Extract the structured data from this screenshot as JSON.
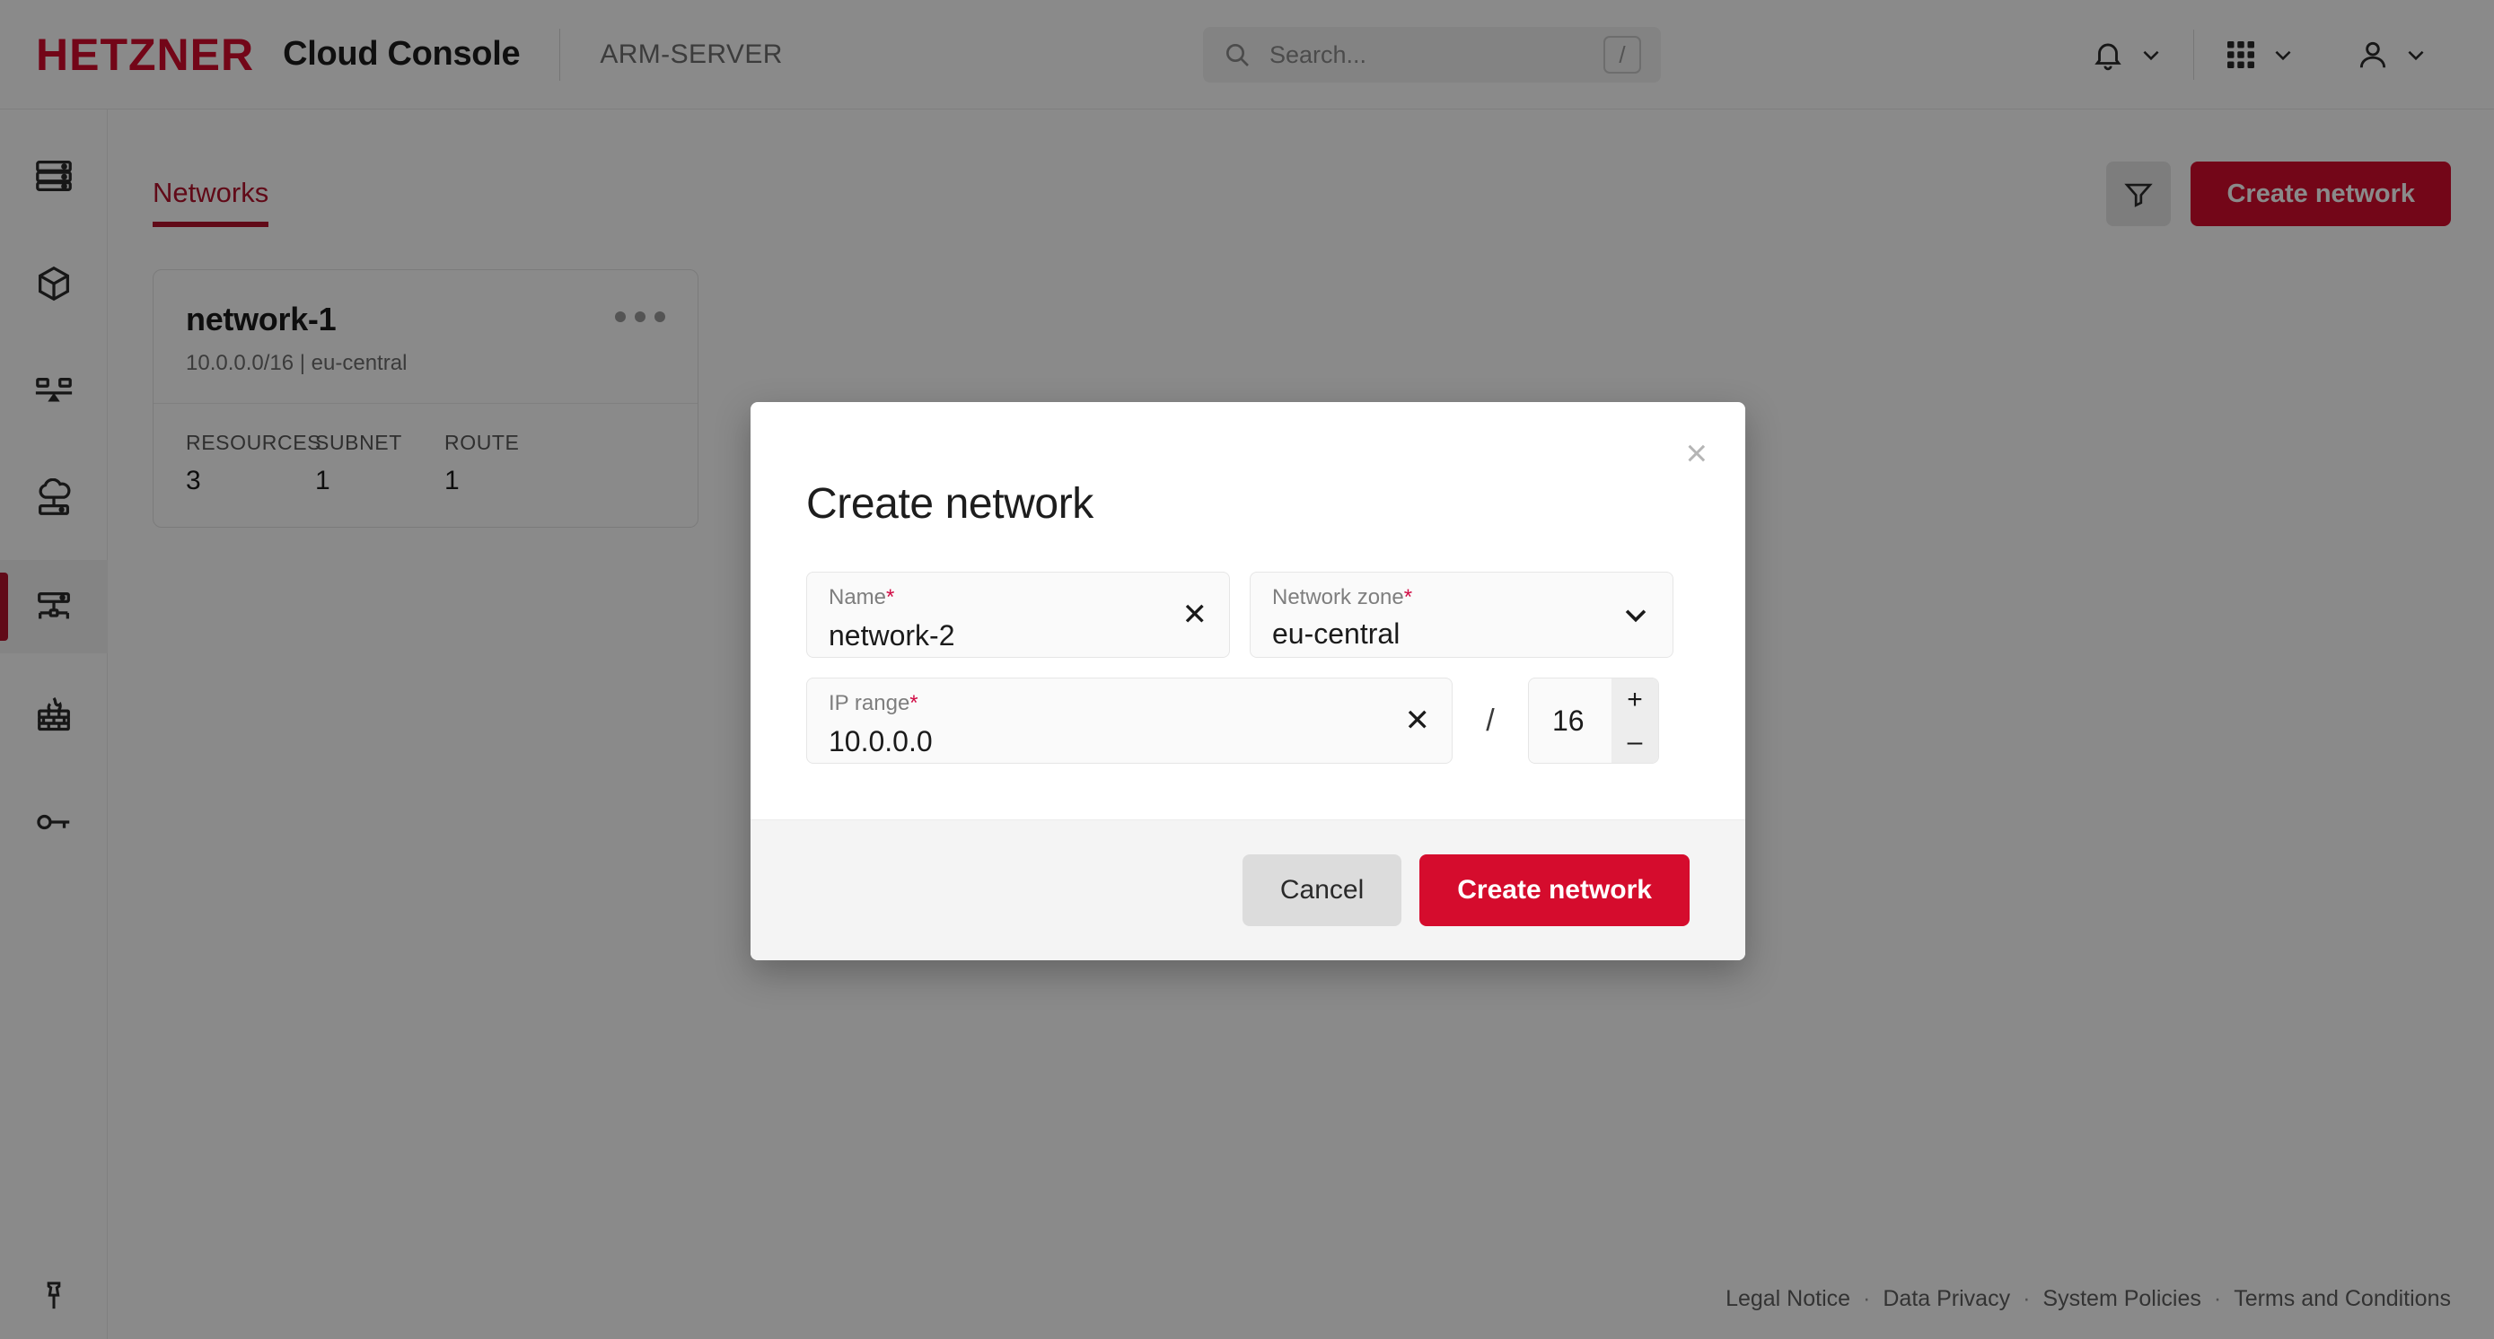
{
  "header": {
    "logo": "HETZNER",
    "console_title": "Cloud Console",
    "project_name": "ARM-SERVER",
    "search": {
      "placeholder": "Search...",
      "shortcut": "/"
    }
  },
  "sidebar": {
    "items": [
      {
        "icon": "servers-icon",
        "name": "servers"
      },
      {
        "icon": "volumes-icon",
        "name": "volumes"
      },
      {
        "icon": "load-balancers-icon",
        "name": "load-balancers"
      },
      {
        "icon": "cloud-storage-icon",
        "name": "storage-boxes"
      },
      {
        "icon": "networks-icon",
        "name": "networks",
        "active": true
      },
      {
        "icon": "firewall-icon",
        "name": "firewalls"
      },
      {
        "icon": "ssh-keys-icon",
        "name": "security"
      }
    ],
    "pin": "pin-icon"
  },
  "main": {
    "tabs": [
      {
        "label": "Networks",
        "active": true
      }
    ],
    "toolbar": {
      "filter_label": "filter",
      "create_label": "Create network"
    },
    "cards": [
      {
        "title": "network-1",
        "subtitle": "10.0.0.0/16 | eu-central",
        "menu": "more-options",
        "stats": [
          {
            "label": "RESOURCES",
            "value": "3"
          },
          {
            "label": "SUBNET",
            "value": "1"
          },
          {
            "label": "ROUTE",
            "value": "1"
          }
        ]
      }
    ]
  },
  "footer": {
    "links": [
      "Legal Notice",
      "Data Privacy",
      "System Policies",
      "Terms and Conditions"
    ],
    "separator": "·"
  },
  "modal": {
    "title": "Create network",
    "close": "×",
    "fields": {
      "name": {
        "label": "Name",
        "required": "*",
        "value": "network-2",
        "clear": "✕"
      },
      "zone": {
        "label": "Network zone",
        "required": "*",
        "value": "eu-central"
      },
      "iprange": {
        "label": "IP range",
        "required": "*",
        "value": "10.0.0.0",
        "clear": "✕"
      }
    },
    "slash": "/",
    "cidr": {
      "value": "16",
      "increment": "+",
      "decrement": "–"
    },
    "buttons": {
      "cancel": "Cancel",
      "submit": "Create network"
    }
  },
  "colors": {
    "brand_red": "#d50c2d",
    "brand_dark_red": "#b3142d",
    "required_red": "#d10c45"
  }
}
